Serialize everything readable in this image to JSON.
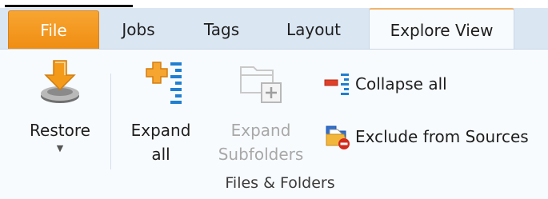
{
  "tabs": {
    "file": "File",
    "jobs": "Jobs",
    "tags": "Tags",
    "layout": "Layout",
    "explore_view": "Explore View"
  },
  "ribbon": {
    "restore": {
      "label": "Restore",
      "icon": "restore-icon"
    },
    "expand_all": {
      "line1": "Expand",
      "line2": "all",
      "icon": "expand-all-icon"
    },
    "expand_subfolders": {
      "line1": "Expand",
      "line2": "Subfolders",
      "icon": "expand-subfolders-icon",
      "enabled": false
    },
    "collapse_all": {
      "label": "Collapse all",
      "icon": "collapse-all-icon"
    },
    "exclude_from_sources": {
      "label": "Exclude from Sources",
      "icon": "exclude-icon"
    },
    "group_label": "Files & Folders"
  },
  "colors": {
    "file_tab": "#f08d13",
    "tab_bar": "#dbe6f3",
    "ribbon_bg": "#f8fbfe",
    "accent_blue": "#1f7fd1"
  }
}
